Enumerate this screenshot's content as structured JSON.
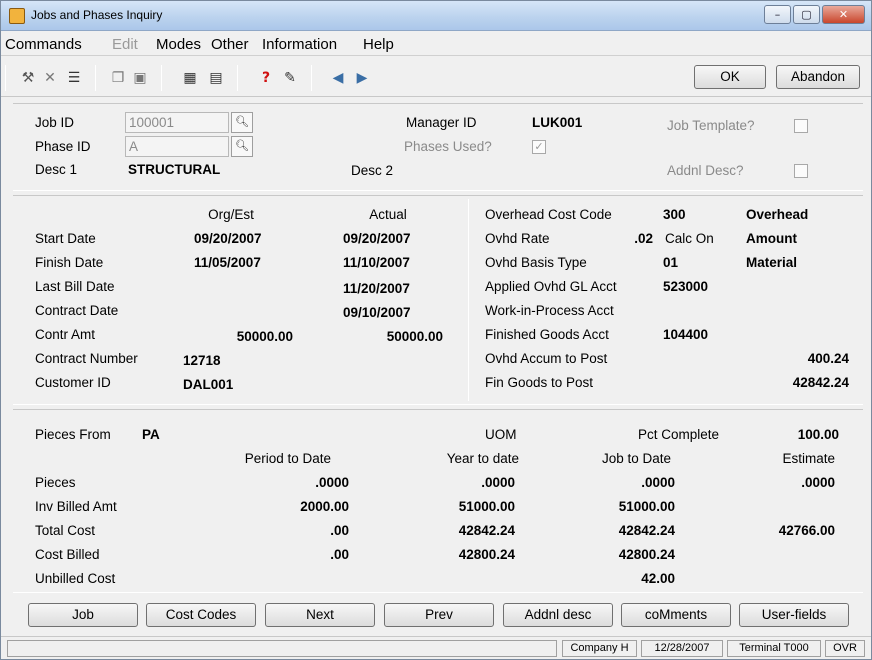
{
  "window": {
    "title": "Jobs and Phases Inquiry",
    "minimize": "–",
    "maximize": "▢",
    "close": "✕"
  },
  "menu": [
    {
      "label": "Commands",
      "disabled": false
    },
    {
      "label": "Edit",
      "disabled": true
    },
    {
      "label": "Modes",
      "disabled": false
    },
    {
      "label": "Other",
      "disabled": false
    },
    {
      "label": "Information",
      "disabled": false
    },
    {
      "label": "Help",
      "disabled": false
    }
  ],
  "toolbar": {
    "icons": [
      "tools-icon",
      "delete-icon",
      "list-icon",
      "copy-icon",
      "paste-icon",
      "calculator-icon",
      "calendar-icon",
      "help-icon",
      "notes-icon",
      "back-icon",
      "forward-icon"
    ],
    "ok_label": "OK",
    "abandon_label": "Abandon"
  },
  "header": {
    "job_id_label": "Job ID",
    "job_id": "100001",
    "phase_id_label": "Phase ID",
    "phase_id": "A",
    "desc1_label": "Desc 1",
    "desc1": "STRUCTURAL",
    "desc2_label": "Desc 2",
    "manager_id_label": "Manager ID",
    "manager_id": "LUK001",
    "phases_used_label": "Phases Used?",
    "phases_used": "✓",
    "job_template_label": "Job Template?",
    "addnl_desc_label": "Addnl Desc?"
  },
  "dates": {
    "col_orgest": "Org/Est",
    "col_actual": "Actual",
    "rows": [
      {
        "label": "Start Date",
        "orgest": "09/20/2007",
        "actual": "09/20/2007"
      },
      {
        "label": "Finish Date",
        "orgest": "11/05/2007",
        "actual": "11/10/2007"
      },
      {
        "label": "Last Bill Date",
        "orgest": "",
        "actual": "11/20/2007"
      },
      {
        "label": "Contract Date",
        "orgest": "",
        "actual": "09/10/2007"
      },
      {
        "label": "Contr Amt",
        "orgest": "50000.00",
        "actual": "50000.00"
      }
    ],
    "contract_number_label": "Contract Number",
    "contract_number": "12718",
    "customer_id_label": "Customer ID",
    "customer_id": "DAL001"
  },
  "overhead": {
    "cost_code_label": "Overhead Cost Code",
    "cost_code": "300",
    "cost_code_desc": "Overhead",
    "rate_label": "Ovhd Rate",
    "rate": ".02",
    "calc_on_label": "Calc On",
    "calc_on": "Amount",
    "basis_label": "Ovhd Basis Type",
    "basis": "01",
    "basis_desc": "Material",
    "applied_gl_label": "Applied Ovhd GL Acct",
    "applied_gl": "523000",
    "wip_label": "Work-in-Process Acct",
    "finished_goods_label": "Finished Goods Acct",
    "finished_goods": "104400",
    "accum_label": "Ovhd Accum to Post",
    "accum": "400.24",
    "fin_goods_post_label": "Fin Goods to Post",
    "fin_goods_post": "42842.24"
  },
  "stats": {
    "pieces_from_label": "Pieces From",
    "pieces_from": "PA",
    "uom_label": "UOM",
    "pct_complete_label": "Pct Complete",
    "pct_complete": "100.00",
    "columns": [
      "Period to Date",
      "Year to date",
      "Job to Date",
      "Estimate"
    ],
    "rows": [
      {
        "label": "Pieces",
        "ptd": ".0000",
        "ytd": ".0000",
        "jtd": ".0000",
        "est": ".0000"
      },
      {
        "label": "Inv Billed Amt",
        "ptd": "2000.00",
        "ytd": "51000.00",
        "jtd": "51000.00",
        "est": ""
      },
      {
        "label": "Total Cost",
        "ptd": ".00",
        "ytd": "42842.24",
        "jtd": "42842.24",
        "est": "42766.00"
      },
      {
        "label": "Cost Billed",
        "ptd": ".00",
        "ytd": "42800.24",
        "jtd": "42800.24",
        "est": ""
      },
      {
        "label": "Unbilled Cost",
        "ptd": "",
        "ytd": "",
        "jtd": "42.00",
        "est": ""
      }
    ]
  },
  "buttons": [
    "Job",
    "Cost Codes",
    "Next",
    "Prev",
    "Addnl desc",
    "coMments",
    "User-fields"
  ],
  "status": {
    "company": "Company H",
    "date": "12/28/2007",
    "terminal": "Terminal T000",
    "mode": "OVR"
  }
}
